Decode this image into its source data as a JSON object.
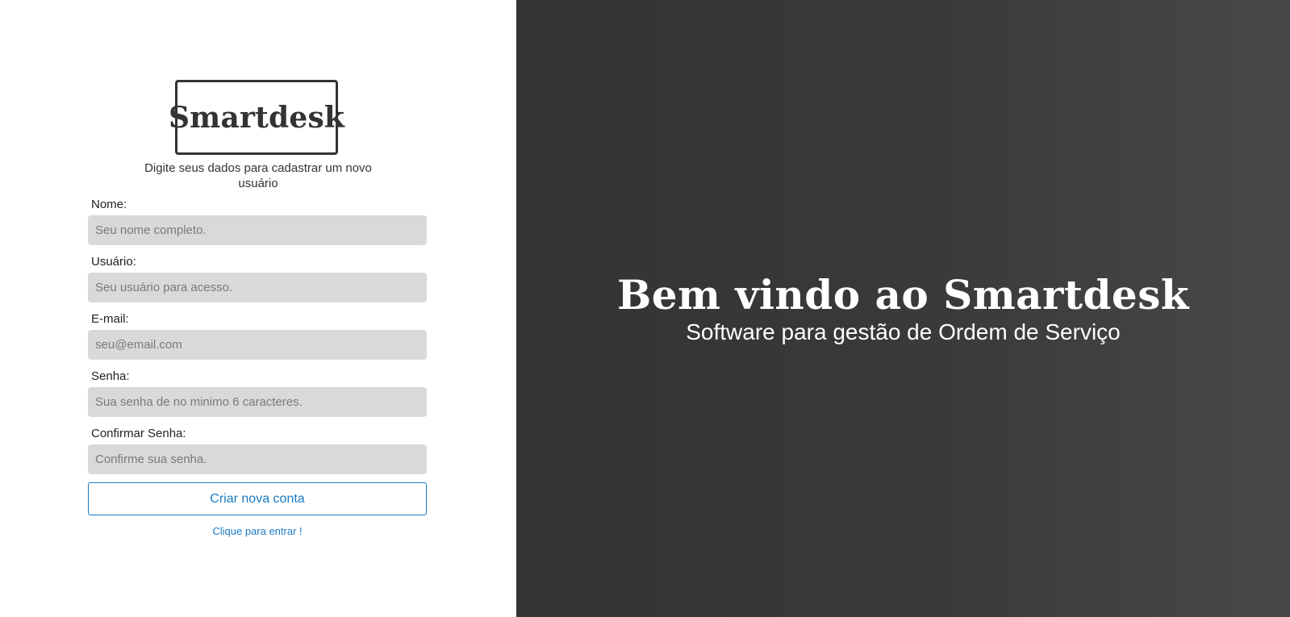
{
  "brand": {
    "logo_text": "Smartdesk"
  },
  "form": {
    "instruction": "Digite seus dados para cadastrar um novo usuário",
    "fields": [
      {
        "label": "Nome:",
        "placeholder": "Seu nome completo.",
        "value": ""
      },
      {
        "label": "Usuário:",
        "placeholder": "Seu usuário para acesso.",
        "value": ""
      },
      {
        "label": "E-mail:",
        "placeholder": "seu@email.com",
        "value": ""
      },
      {
        "label": "Senha:",
        "placeholder": "Sua senha de no minimo 6 caracteres.",
        "value": ""
      },
      {
        "label": "Confirmar Senha:",
        "placeholder": "Confirme sua senha.",
        "value": ""
      }
    ],
    "submit_label": "Criar nova conta",
    "login_link_label": "Clique para entrar !"
  },
  "welcome": {
    "title": "Bem vindo ao Smartdesk",
    "subtitle": "Software para gestão de Ordem de Serviço"
  },
  "colors": {
    "accent": "#1a7bc6",
    "input_bg": "#d9d9d9",
    "dark_panel": "#333333",
    "text_dark": "#333333"
  }
}
